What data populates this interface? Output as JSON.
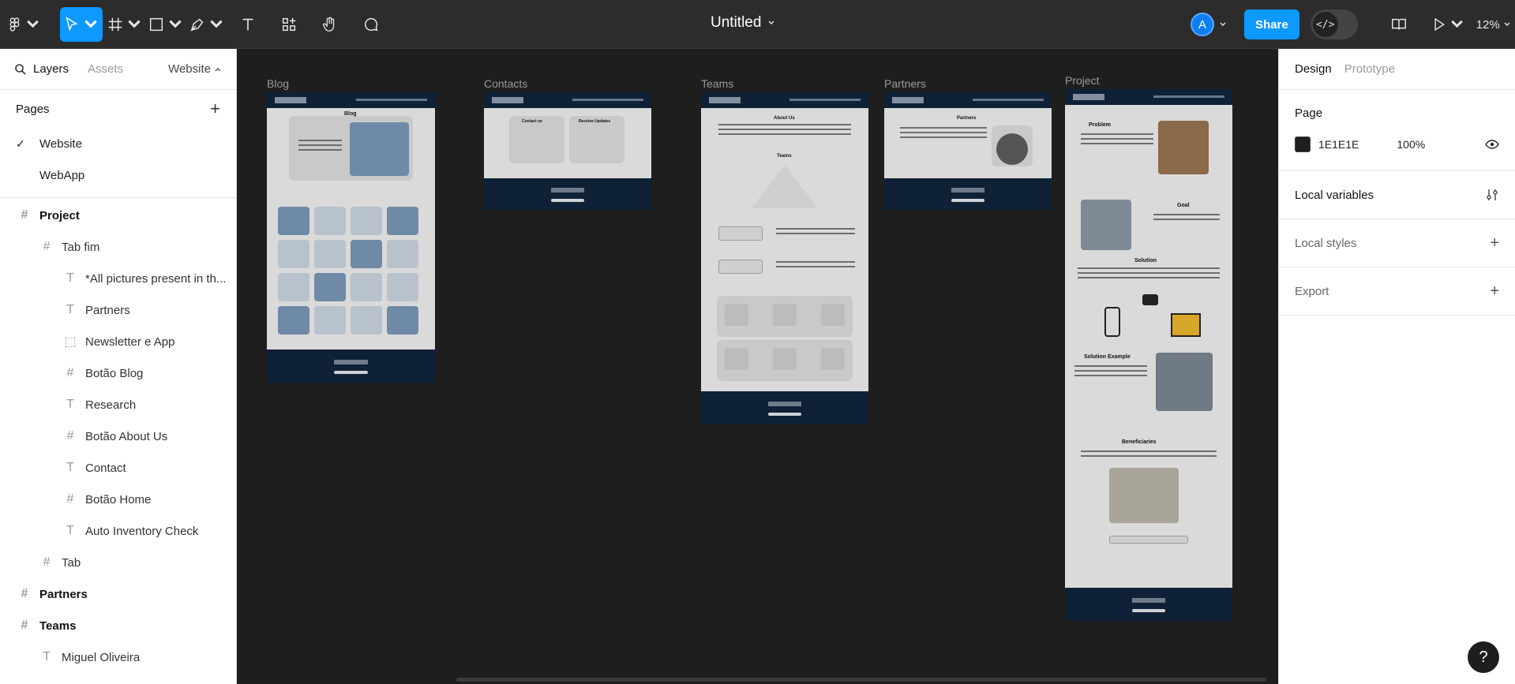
{
  "toolbar": {
    "file_title": "Untitled",
    "avatar_initial": "A",
    "share_label": "Share",
    "dev_mode_glyph": "</>",
    "zoom": "12%"
  },
  "left": {
    "tabs": {
      "layers": "Layers",
      "assets": "Assets",
      "page": "Website"
    },
    "pages_heading": "Pages",
    "pages": [
      {
        "label": "Website",
        "selected": true
      },
      {
        "label": "WebApp",
        "selected": false
      }
    ],
    "layers": [
      {
        "label": "Project",
        "type": "frame",
        "level": 0
      },
      {
        "label": "Tab fim",
        "type": "frame",
        "level": 1
      },
      {
        "label": "*All pictures present in th...",
        "type": "text",
        "level": 2
      },
      {
        "label": "Partners",
        "type": "text",
        "level": 2
      },
      {
        "label": "Newsletter e App",
        "type": "section",
        "level": 2
      },
      {
        "label": "Botão Blog",
        "type": "frame",
        "level": 2
      },
      {
        "label": "Research",
        "type": "text",
        "level": 2
      },
      {
        "label": "Botão About Us",
        "type": "frame",
        "level": 2
      },
      {
        "label": "Contact",
        "type": "text",
        "level": 2
      },
      {
        "label": "Botão Home",
        "type": "frame",
        "level": 2
      },
      {
        "label": "Auto Inventory Check",
        "type": "text",
        "level": 2
      },
      {
        "label": "Tab",
        "type": "frame",
        "level": 1
      },
      {
        "label": "Partners",
        "type": "frame",
        "level": 0
      },
      {
        "label": "Teams",
        "type": "frame",
        "level": 0
      },
      {
        "label": "Miguel Oliveira",
        "type": "text",
        "level": 1
      }
    ]
  },
  "canvas": {
    "frames": {
      "blog": "Blog",
      "contacts": "Contacts",
      "teams": "Teams",
      "partners": "Partners",
      "project": "Project"
    },
    "mini": {
      "blog_heading": "Blog",
      "contact_heading": "Contact us",
      "receive_heading": "Receive Updates",
      "about_heading": "About Us",
      "teams_heading": "Teams",
      "partners_heading": "Partners",
      "problem": "Problem",
      "goal": "Goal",
      "solution": "Solution",
      "solution_example": "Solution Example",
      "beneficiaries": "Beneficiaries"
    }
  },
  "right": {
    "tabs": {
      "design": "Design",
      "prototype": "Prototype"
    },
    "page_heading": "Page",
    "page_color": "1E1E1E",
    "page_opacity": "100%",
    "local_variables": "Local variables",
    "local_styles": "Local styles",
    "export": "Export",
    "help": "?"
  }
}
